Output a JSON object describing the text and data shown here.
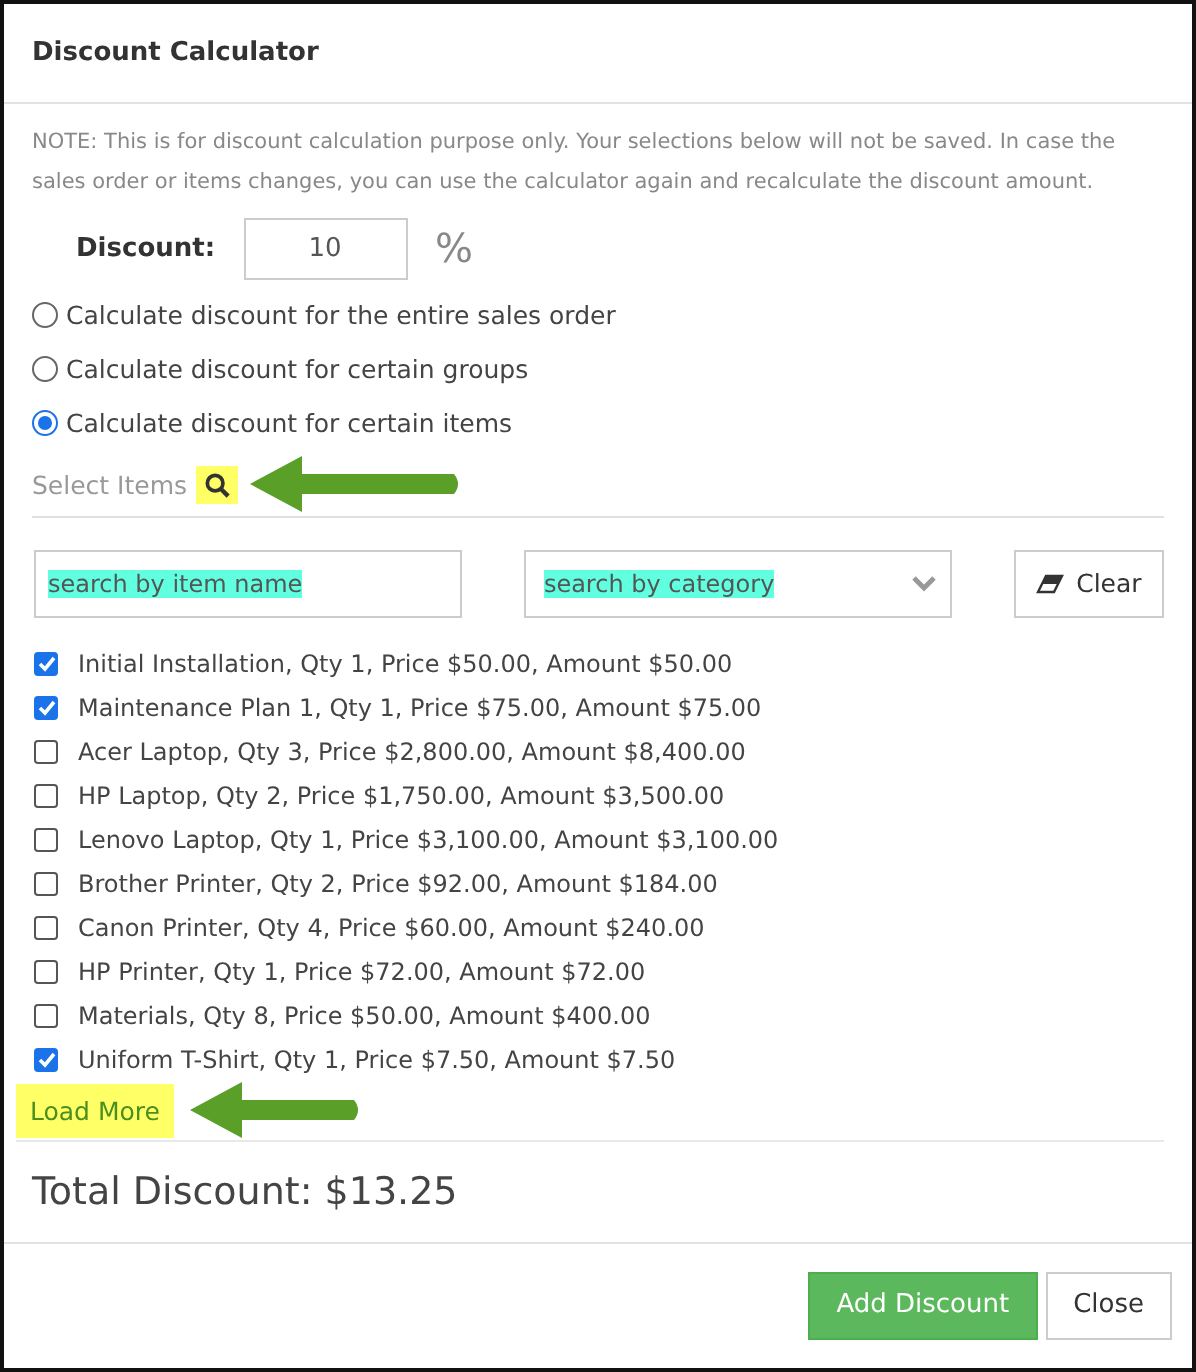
{
  "dialog": {
    "title": "Discount Calculator"
  },
  "note": "NOTE: This is for discount calculation purpose only. Your selections below will not be saved. In case the sales order or items changes, you can use the calculator again and recalculate the discount amount.",
  "discount": {
    "label": "Discount:",
    "value": "10",
    "unit": "%"
  },
  "modes": [
    {
      "label": "Calculate discount for the entire sales order",
      "selected": false
    },
    {
      "label": "Calculate discount for certain groups",
      "selected": false
    },
    {
      "label": "Calculate discount for certain items",
      "selected": true
    }
  ],
  "select_items": {
    "label": "Select Items",
    "highlighted": true
  },
  "filters": {
    "name_placeholder": "search by item name",
    "category_placeholder": "search by category",
    "clear": "Clear"
  },
  "items": [
    {
      "label": "Initial Installation, Qty 1, Price $50.00, Amount $50.00",
      "checked": true
    },
    {
      "label": "Maintenance Plan 1, Qty 1, Price $75.00, Amount $75.00",
      "checked": true
    },
    {
      "label": "Acer Laptop, Qty 3, Price $2,800.00, Amount $8,400.00",
      "checked": false
    },
    {
      "label": "HP Laptop, Qty 2, Price $1,750.00, Amount $3,500.00",
      "checked": false
    },
    {
      "label": "Lenovo Laptop, Qty 1, Price $3,100.00, Amount $3,100.00",
      "checked": false
    },
    {
      "label": "Brother Printer, Qty 2, Price $92.00, Amount $184.00",
      "checked": false
    },
    {
      "label": "Canon Printer, Qty 4, Price $60.00, Amount $240.00",
      "checked": false
    },
    {
      "label": "HP Printer, Qty 1, Price $72.00, Amount $72.00",
      "checked": false
    },
    {
      "label": "Materials, Qty 8, Price $50.00, Amount $400.00",
      "checked": false
    },
    {
      "label": "Uniform T-Shirt, Qty 1, Price $7.50, Amount $7.50",
      "checked": true
    }
  ],
  "load_more": {
    "label": "Load More",
    "highlighted": true
  },
  "total": "Total Discount: $13.25",
  "buttons": [
    {
      "label": "Add Discount",
      "kind": "primary"
    },
    {
      "label": "Close",
      "kind": "default"
    }
  ]
}
